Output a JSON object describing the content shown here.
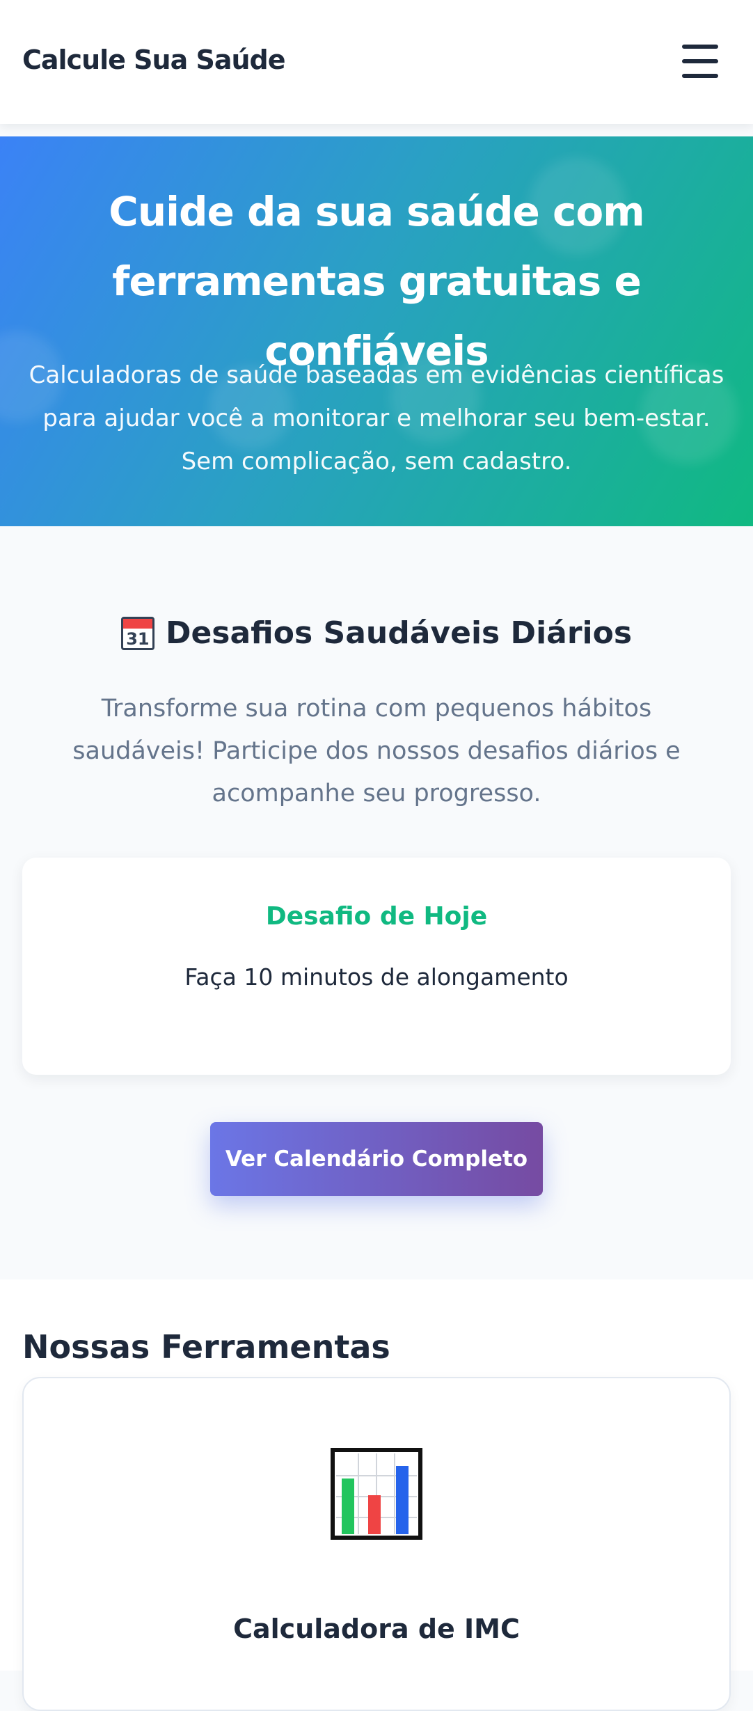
{
  "header": {
    "brand": "Calcule Sua Saúde",
    "menu_icon": "hamburger-menu-icon"
  },
  "hero": {
    "title": "Cuide da sua saúde com ferramentas gratuitas e confiáveis",
    "subtitle": "Calculadoras de saúde baseadas em evidências científicas para ajudar você a monitorar e melhorar seu bem-estar. Sem complicação, sem cadastro.",
    "gradient": [
      "#3b82f6",
      "#10b981"
    ]
  },
  "challenges": {
    "icon": "calendar-icon",
    "icon_day": "31",
    "title": "Desafios Saudáveis Diários",
    "description": "Transforme sua rotina com pequenos hábitos saudáveis! Participe dos nossos desafios diários e acompanhe seu progresso.",
    "today_label": "Desafio de Hoje",
    "today_challenge": "Faça 10 minutos de alongamento",
    "button_label": "Ver Calendário Completo",
    "accent": "#10b981"
  },
  "tools": {
    "title": "Nossas Ferramentas",
    "items": [
      {
        "name": "Calculadora de IMC",
        "icon": "bar-chart-icon"
      }
    ]
  }
}
